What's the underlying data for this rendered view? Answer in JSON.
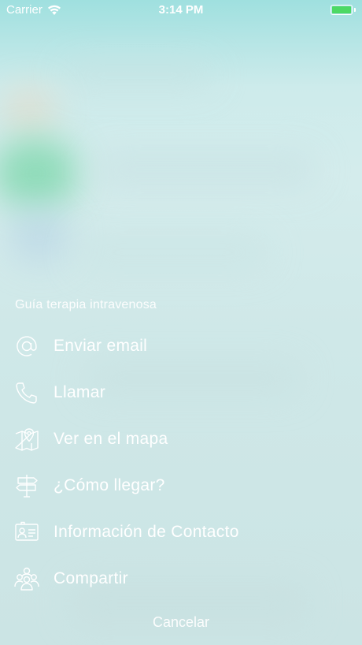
{
  "status_bar": {
    "carrier": "Carrier",
    "time": "3:14 PM",
    "battery_level": 1.0
  },
  "action_sheet": {
    "title": "Guía terapia intravenosa",
    "options": [
      {
        "label": "Enviar email",
        "icon": "at-sign-icon"
      },
      {
        "label": "Llamar",
        "icon": "phone-icon"
      },
      {
        "label": "Ver en el mapa",
        "icon": "map-pin-icon"
      },
      {
        "label": "¿Cómo llegar?",
        "icon": "signpost-icon"
      },
      {
        "label": "Información de Contacto",
        "icon": "contact-card-icon"
      },
      {
        "label": "Compartir",
        "icon": "people-icon"
      }
    ],
    "cancel_label": "Cancelar"
  },
  "colors": {
    "text": "#ffffff",
    "background": "#d4ecec",
    "battery": "#4cd964"
  }
}
